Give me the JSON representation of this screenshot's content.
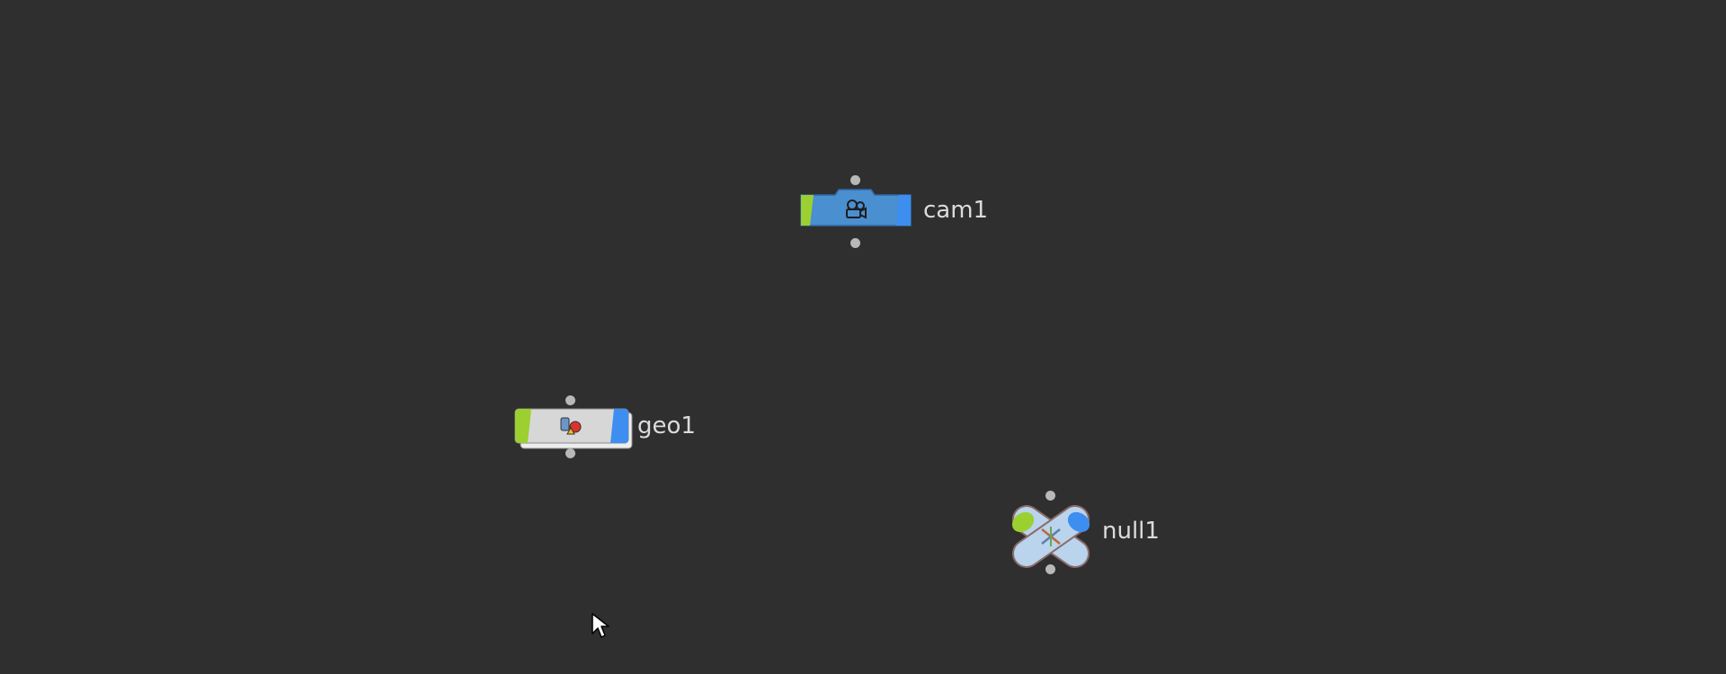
{
  "network": {
    "nodes": [
      {
        "label": "cam1",
        "type": "camera",
        "icon": "camera-icon"
      },
      {
        "label": "geo1",
        "type": "geometry",
        "icon": "geometry-shapes-icon"
      },
      {
        "label": "null1",
        "type": "null",
        "icon": "null-cross-icon"
      }
    ]
  },
  "colors": {
    "background": "#2f2f2f",
    "display_flag": "#9bd030",
    "render_flag": "#3d8ef0",
    "camera_body": "#4a8fd0",
    "geometry_body": "#d7d7d7",
    "null_body": "#b9d4ec",
    "connector": "#b8b8b8",
    "label_text": "#dcdcdc"
  },
  "cursor": {
    "icon": "mouse-pointer-icon"
  }
}
